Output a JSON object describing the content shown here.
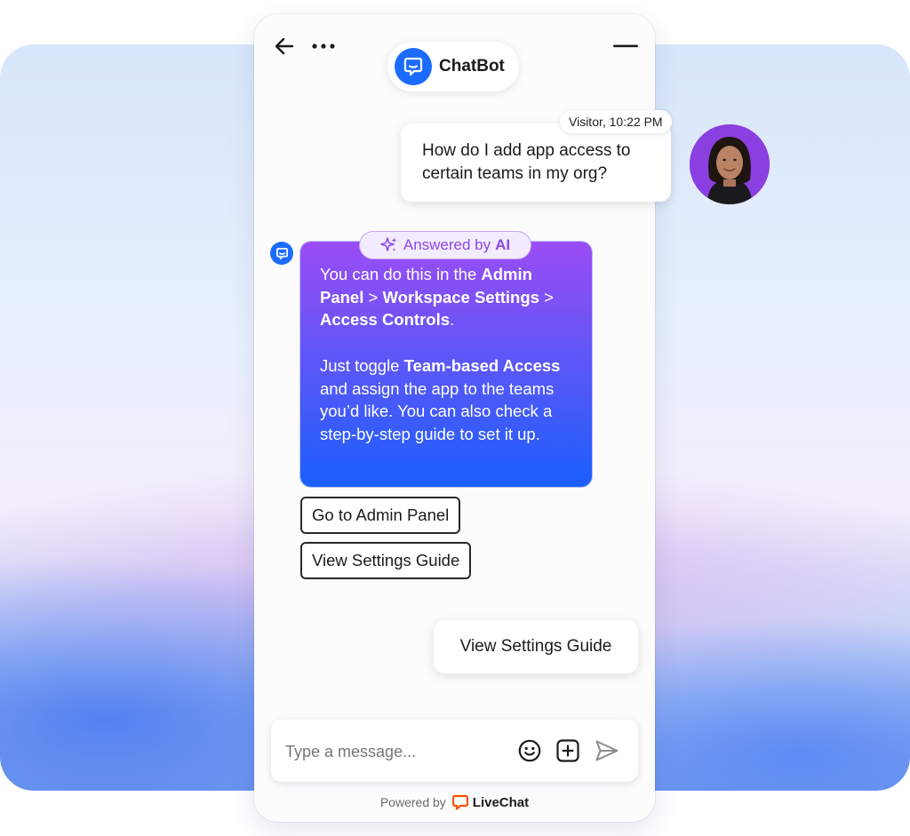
{
  "header": {
    "title": "ChatBot",
    "back_icon": "arrow-left-icon",
    "more_icon": "more-horizontal-icon",
    "minimize_icon": "minimize-icon"
  },
  "messages": {
    "visitor": {
      "meta": "Visitor, 10:22 PM",
      "text": "How do I add app access to certain teams in my org?"
    },
    "bot": {
      "badge_prefix": "Answered by",
      "badge_ai": "AI",
      "p1_a": "You can do this in the ",
      "p1_b": "Admin Panel",
      "p1_c": " > ",
      "p1_d": "Workspace Settings",
      "p1_e": " > ",
      "p1_f": "Access Controls",
      "p1_g": ".",
      "p2_a": "Just toggle ",
      "p2_b": "Team-based Access",
      "p2_c": " and assign the app to the teams you’d like. You can also check a step-by-step guide to set it up."
    },
    "quick_replies": [
      "Go to Admin Panel",
      "View Settings Guide"
    ],
    "visitor_reply": "View Settings Guide"
  },
  "composer": {
    "placeholder": "Type a message...",
    "emoji_icon": "smiley-icon",
    "attach_icon": "plus-square-icon",
    "send_icon": "send-icon"
  },
  "footer": {
    "powered_by": "Powered by",
    "brand": "LiveChat"
  },
  "colors": {
    "brand_blue": "#1c6bff",
    "ai_gradient_top": "#9b4cf5",
    "ai_gradient_bottom": "#1a5ffc",
    "ai_badge_text": "#8a48e8",
    "livechat_orange": "#ff5100"
  }
}
